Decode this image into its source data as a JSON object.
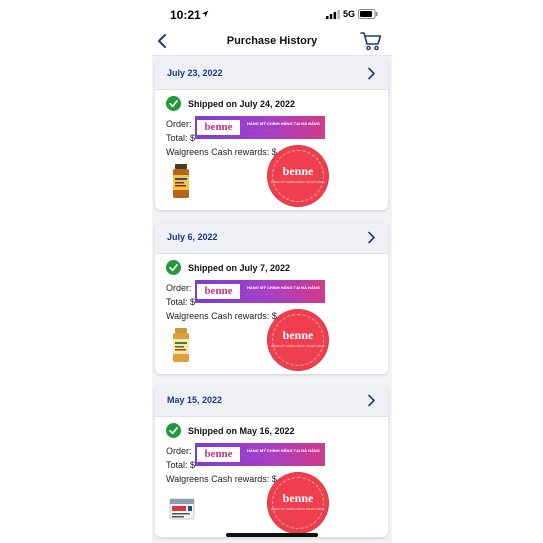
{
  "status_bar": {
    "time": "10:21",
    "network": "5G",
    "icons": [
      "location-arrow-icon",
      "signal-icon",
      "battery-icon"
    ]
  },
  "nav": {
    "title": "Purchase History",
    "icons": [
      "back-chevron-icon",
      "cart-icon"
    ]
  },
  "orders": [
    {
      "date": "July 23, 2022",
      "shipped": "Shipped on July 24, 2022",
      "order_label": "Order:",
      "total_label": "Total: $",
      "rewards_label": "Walgreens Cash rewards: $",
      "product_icon": "supplement-bottle-icon"
    },
    {
      "date": "July 6, 2022",
      "shipped": "Shipped on July 7, 2022",
      "order_label": "Order:",
      "total_label": "Total: $",
      "rewards_label": "Walgreens Cash rewards: $",
      "product_icon": "supplement-bottle-icon"
    },
    {
      "date": "May 15, 2022",
      "shipped": "Shipped on May 16, 2022",
      "order_label": "Order:",
      "total_label": "Total: $",
      "rewards_label": "Walgreens Cash rewards: $",
      "product_icon": "medicine-box-icon"
    }
  ],
  "watermark": {
    "logo": "benne",
    "banner_tagline": "HÀNG MỸ CHÍNH HÃNG TẠI ĐÀ NẴNG"
  },
  "colors": {
    "date_text": "#1b3a8a",
    "check_green": "#1e9a3c",
    "header_bg": "#eef0f6",
    "nav_accent": "#1b3a8a",
    "stamp_red": "#ef3e4d",
    "banner_purple": "#7a3fd4",
    "banner_pink": "#d03a88"
  }
}
